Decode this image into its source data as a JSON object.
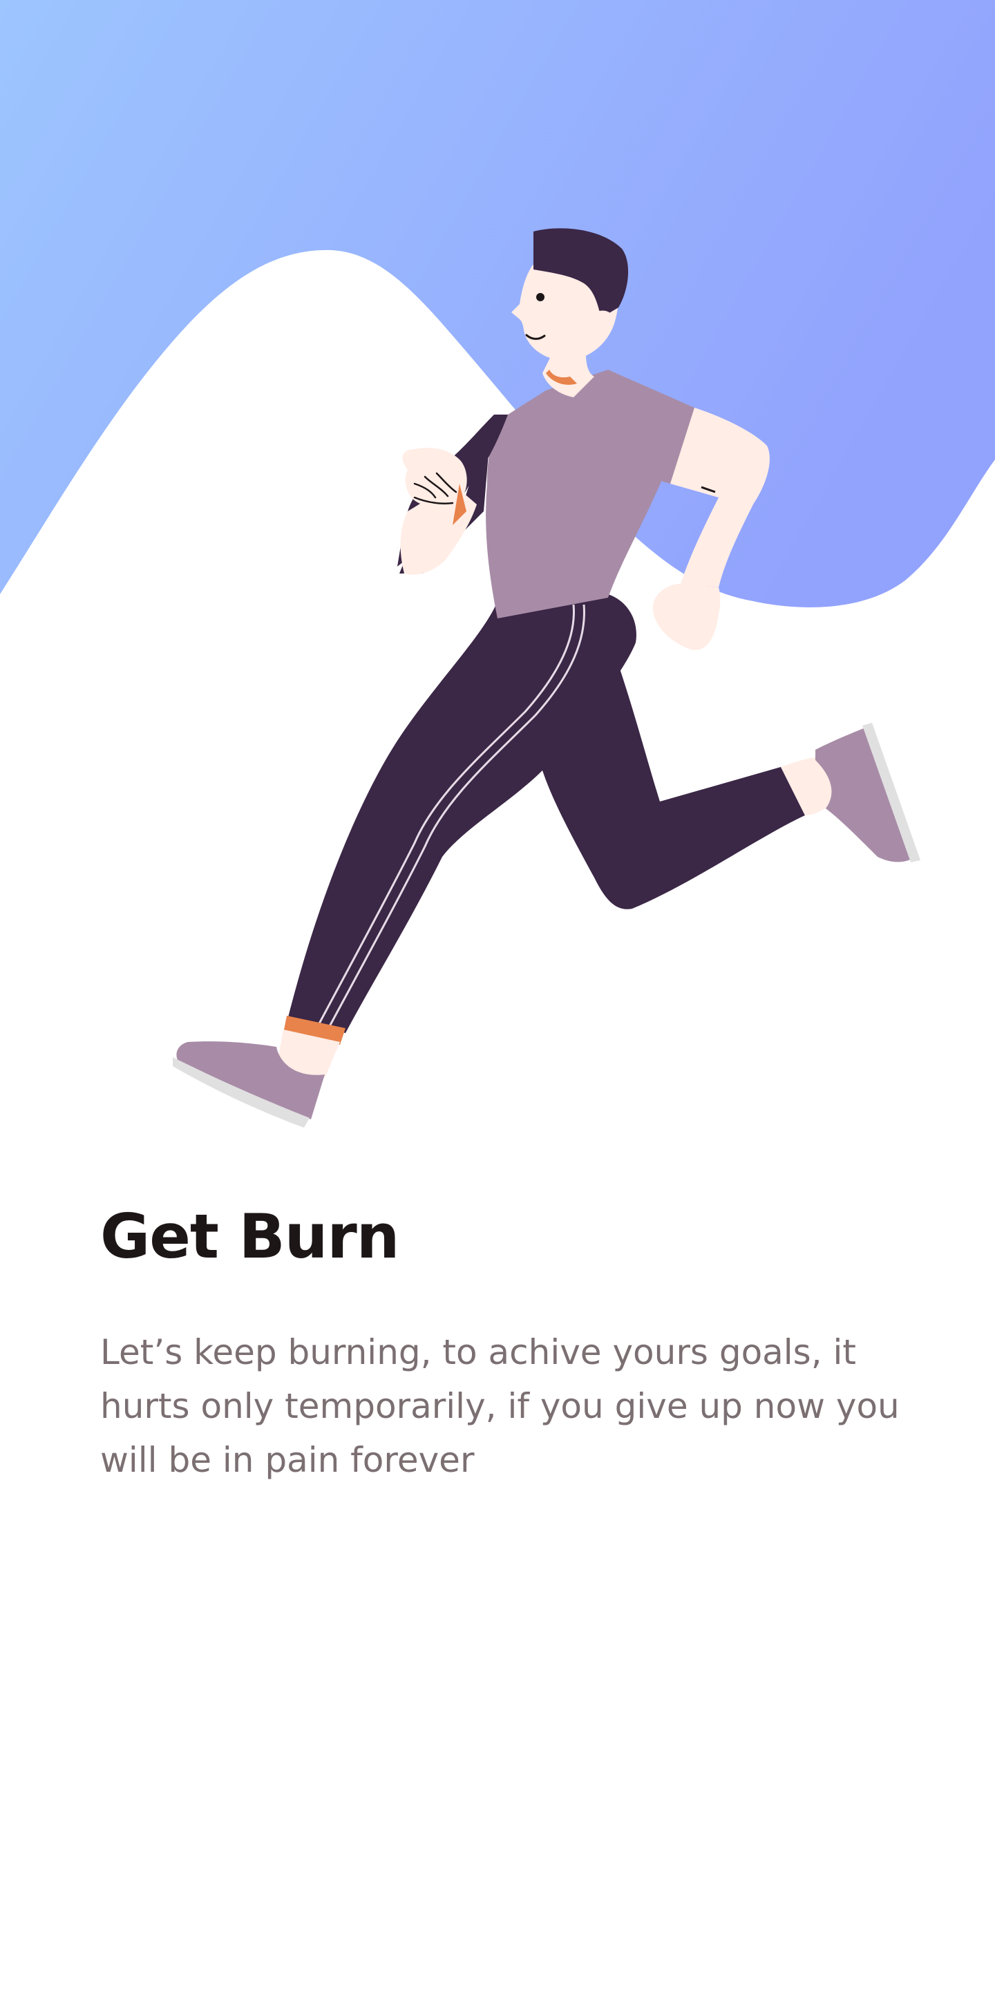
{
  "onboarding": {
    "title": "Get Burn",
    "description": "Let’s keep burning, to achive yours goals, it hurts only temporarily, if you give up now you will be in pain forever"
  },
  "colors": {
    "gradient_start": "#9dc5fe",
    "gradient_end": "#92a3fd",
    "title_text": "#1d1617",
    "body_text": "#7b6f72",
    "shirt": "#a88ca7",
    "pants": "#3b2746",
    "hair": "#3b2746",
    "skin": "#ffede6",
    "accent_orange": "#e8834b"
  },
  "icons": {
    "hero_illustration": "running-man-illustration"
  }
}
